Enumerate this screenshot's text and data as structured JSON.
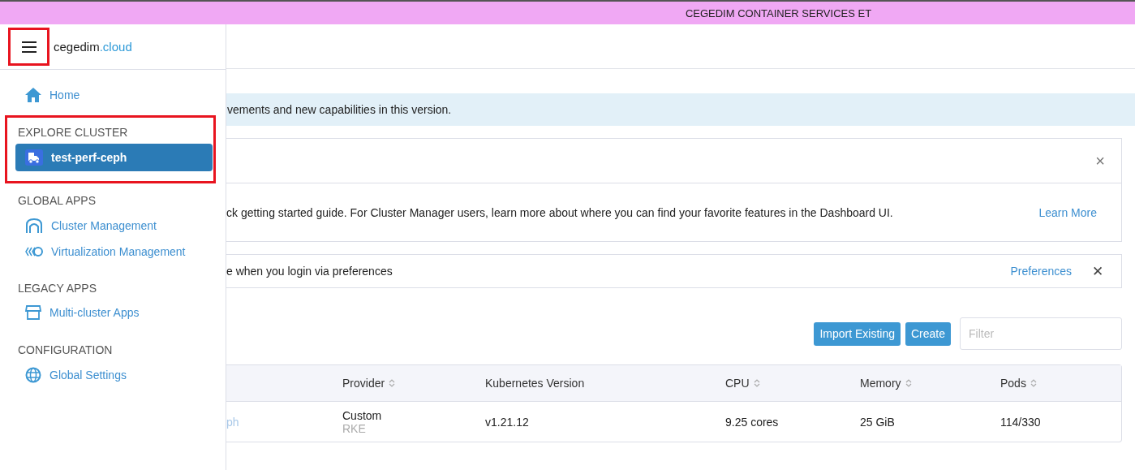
{
  "top_banner": {
    "text": "CEGEDIM CONTAINER SERVICES ET"
  },
  "sidebar": {
    "menu_highlighted": true,
    "logo": {
      "name": "cegedim",
      "suffix": ".cloud"
    },
    "sections": [
      {
        "items": [
          {
            "label": "Home",
            "selected": false
          }
        ]
      },
      {
        "title": "EXPLORE CLUSTER",
        "highlighted": true,
        "items": [
          {
            "label": "test-perf-ceph",
            "selected": true
          }
        ]
      },
      {
        "title": "GLOBAL APPS",
        "highlighted": false,
        "items": [
          {
            "label": "Cluster Management",
            "selected": false
          },
          {
            "label": "Virtualization Management",
            "selected": false
          }
        ]
      },
      {
        "title": "LEGACY APPS",
        "highlighted": false,
        "items": [
          {
            "label": "Multi-cluster Apps",
            "selected": false
          }
        ]
      },
      {
        "title": "CONFIGURATION",
        "highlighted": false,
        "items": [
          {
            "label": "Global Settings",
            "selected": false
          }
        ]
      }
    ]
  },
  "info_banner": {
    "text": "vements and new capabilities in this version."
  },
  "guide_card": {
    "text": "ck getting started guide. For Cluster Manager users, learn more about where you can find your favorite features in the Dashboard UI.",
    "link": "Learn More",
    "close": "×"
  },
  "pref_card": {
    "text": "e when you login via preferences",
    "link": "Preferences",
    "close": "✕"
  },
  "toolbar": {
    "buttons": [
      "Import Existing",
      "Create"
    ],
    "filter": {
      "placeholder": "Filter"
    }
  },
  "table": {
    "columns": [
      {
        "label": "Provider",
        "sortable": true
      },
      {
        "label": "Kubernetes Version",
        "sortable": false
      },
      {
        "label": "CPU",
        "sortable": true
      },
      {
        "label": "Memory",
        "sortable": true
      },
      {
        "label": "Pods",
        "sortable": true
      }
    ],
    "rows": [
      {
        "name": "ph",
        "provider": "Custom",
        "provider_sub": "RKE",
        "version": "v1.21.12",
        "cpu": "9.25 cores",
        "memory": "25 GiB",
        "pods": "114/330"
      }
    ]
  }
}
